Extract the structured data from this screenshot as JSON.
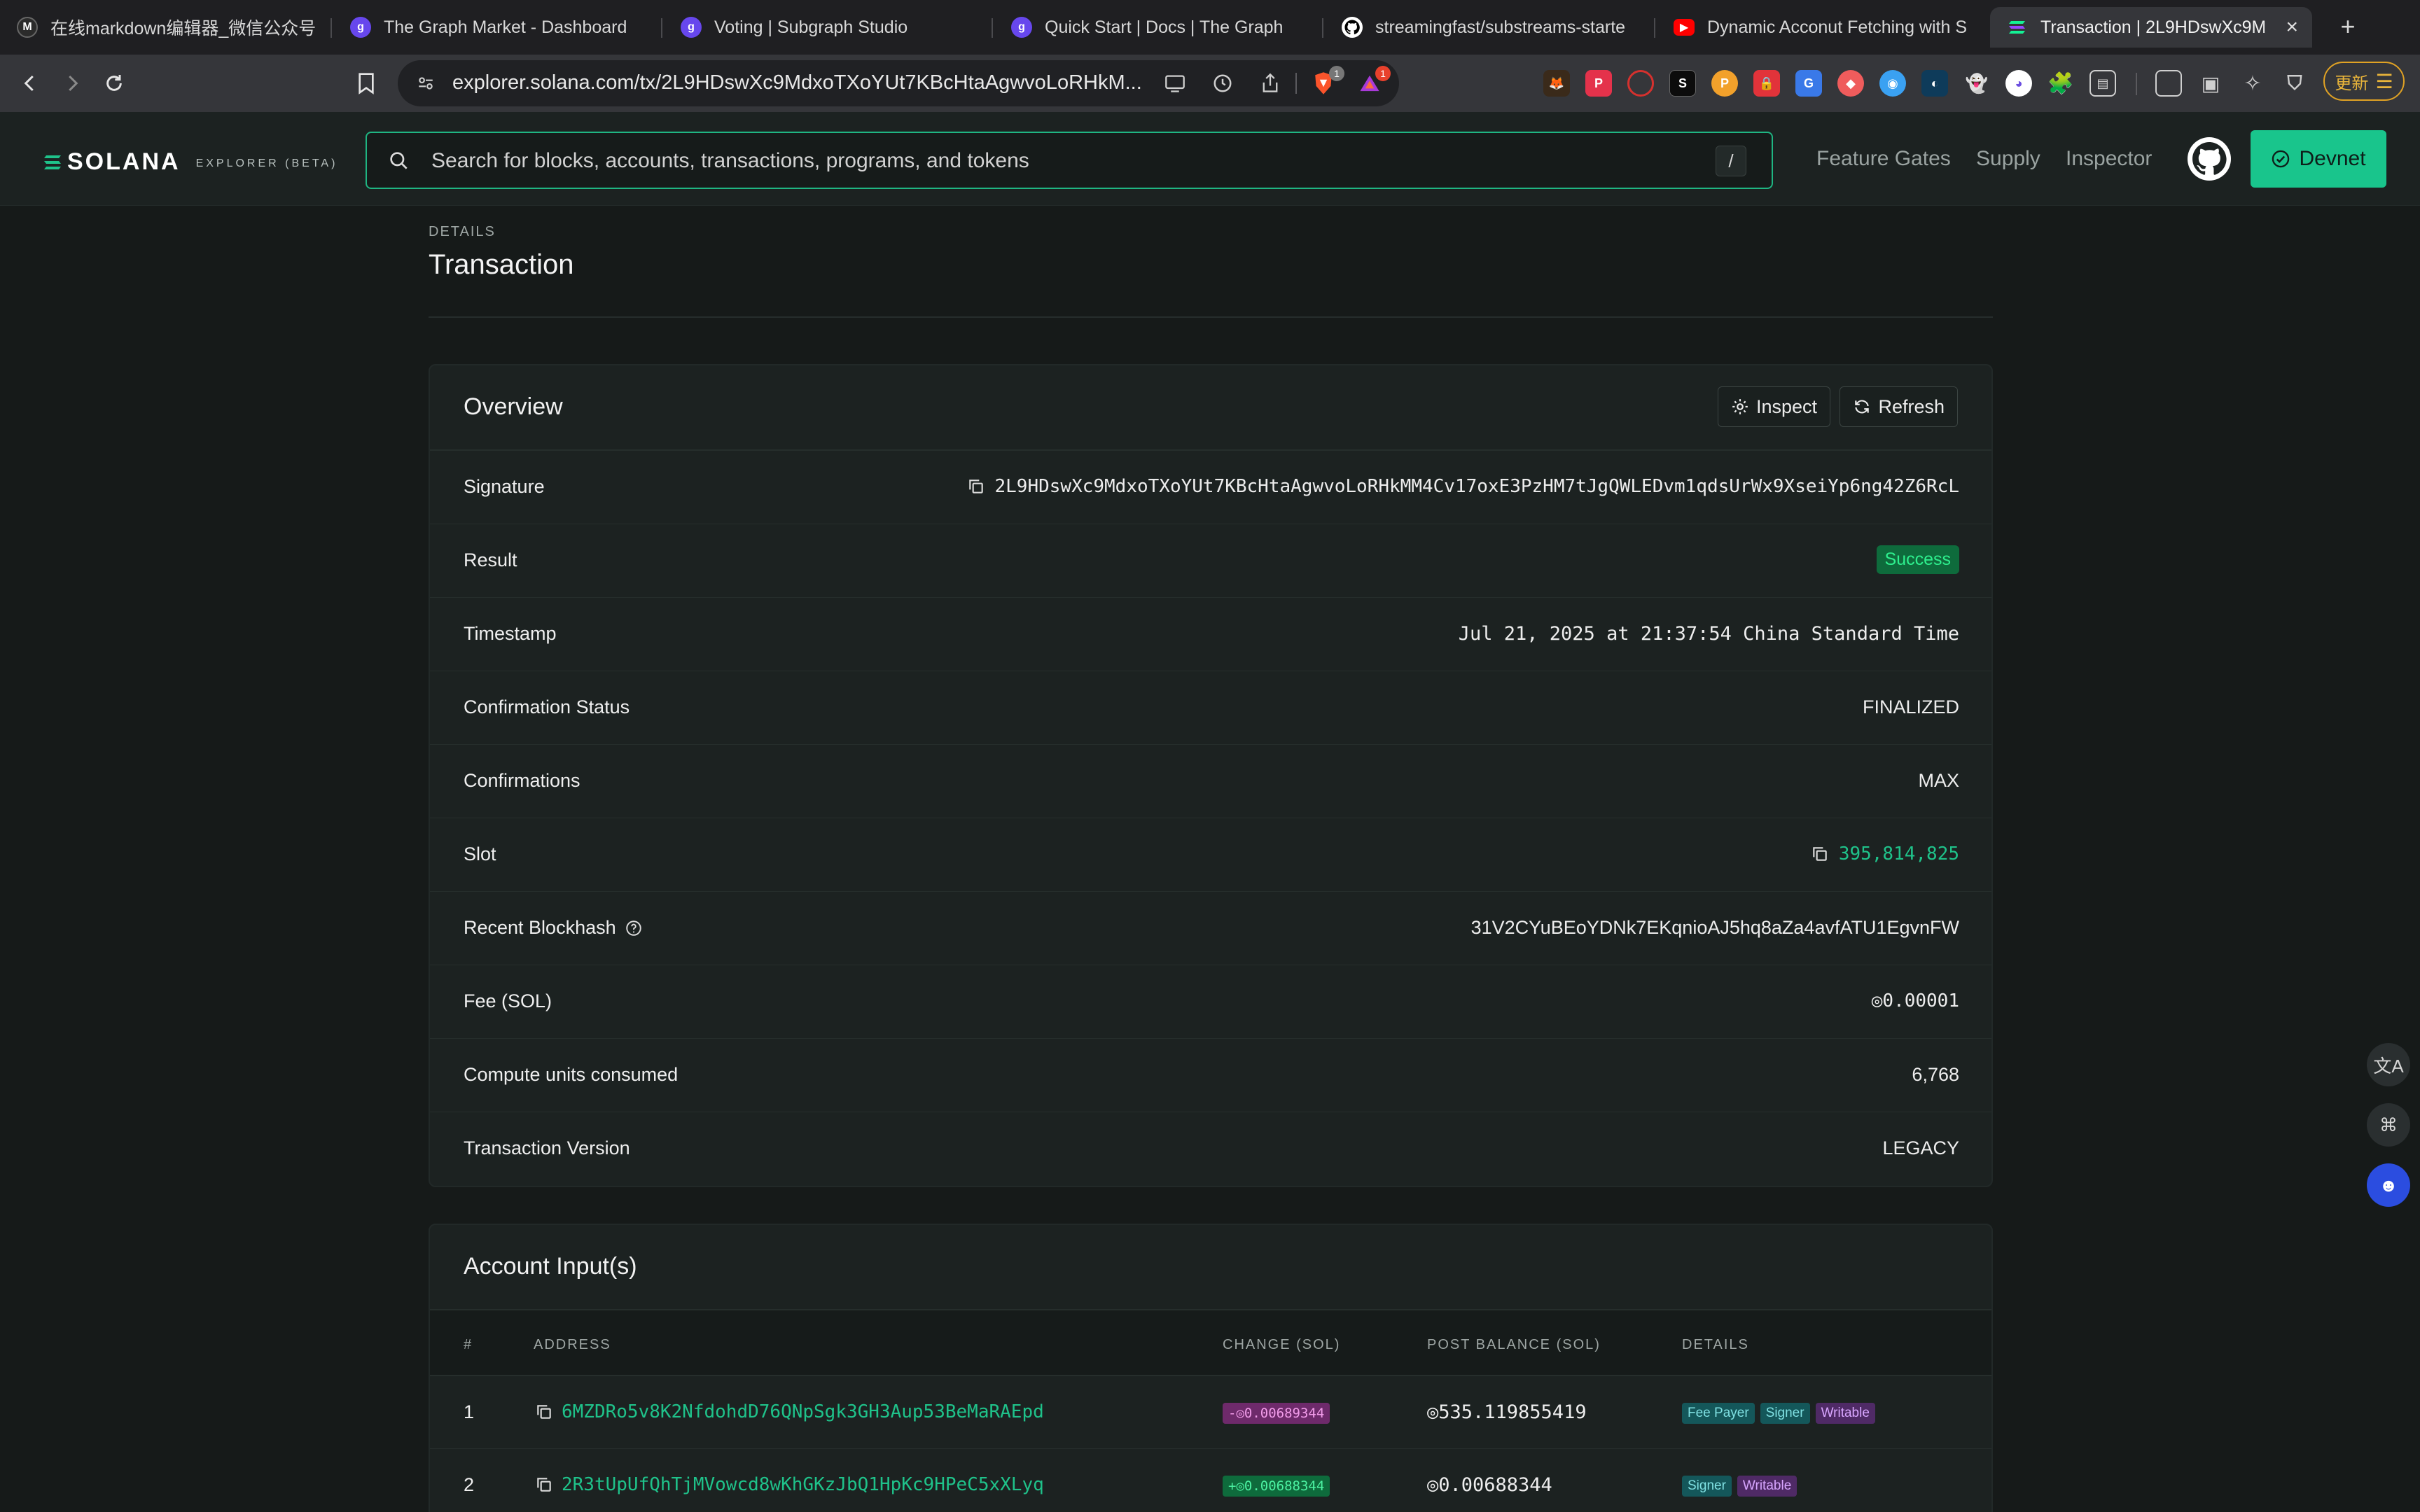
{
  "browser": {
    "tabs": [
      {
        "title": "在线markdown编辑器_微信公众号",
        "icon": "markdown-icon",
        "color": "#2b2b2b"
      },
      {
        "title": "The Graph Market - Dashboard",
        "icon": "the-graph-icon",
        "color": "#6747ed"
      },
      {
        "title": "Voting | Subgraph Studio",
        "icon": "the-graph-icon",
        "color": "#6747ed"
      },
      {
        "title": "Quick Start | Docs | The Graph",
        "icon": "the-graph-icon",
        "color": "#6747ed"
      },
      {
        "title": "streamingfast/substreams-starte",
        "icon": "github-icon",
        "color": "#000000"
      },
      {
        "title": "Dynamic Acconut Fetching with S",
        "icon": "youtube-icon",
        "color": "#ff0000"
      },
      {
        "title": "Transaction | 2L9HDswXc9M",
        "icon": "solana-icon",
        "color": "#14f195"
      }
    ],
    "url": "explorer.solana.com/tx/2L9HDswXc9MdxoTXoYUt7KBcHtaAgwvoLoRHkM...",
    "update_label": "更新",
    "ext_badges": [
      "1",
      "1"
    ]
  },
  "header": {
    "logo_text": "SOLANA",
    "logo_sub": "EXPLORER (BETA)",
    "search_placeholder": "Search for blocks, accounts, transactions, programs, and tokens",
    "search_shortcut": "/",
    "nav": [
      "Feature Gates",
      "Supply",
      "Inspector"
    ],
    "cluster_label": "Devnet",
    "accent": "#19c58c"
  },
  "page": {
    "pre_title": "DETAILS",
    "title": "Transaction"
  },
  "overview": {
    "title": "Overview",
    "inspect_label": "Inspect",
    "refresh_label": "Refresh",
    "rows": {
      "signature": {
        "label": "Signature",
        "value": "2L9HDswXc9MdxoTXoYUt7KBcHtaAgwvoLoRHkMM4Cv17oxE3PzHM7tJgQWLEDvm1qdsUrWx9XseiYp6ng42Z6RcL"
      },
      "result": {
        "label": "Result",
        "value": "Success"
      },
      "timestamp": {
        "label": "Timestamp",
        "value": "Jul 21, 2025 at 21:37:54 China Standard Time"
      },
      "confirmation_status": {
        "label": "Confirmation Status",
        "value": "FINALIZED"
      },
      "confirmations": {
        "label": "Confirmations",
        "value": "MAX"
      },
      "slot": {
        "label": "Slot",
        "value": "395,814,825"
      },
      "recent_blockhash": {
        "label": "Recent Blockhash",
        "value": "31V2CYuBEoYDNk7EKqnioAJ5hq8aZa4avfATU1EgvnFW"
      },
      "fee": {
        "label": "Fee (SOL)",
        "value": "◎0.00001"
      },
      "compute_units": {
        "label": "Compute units consumed",
        "value": "6,768"
      },
      "version": {
        "label": "Transaction Version",
        "value": "LEGACY"
      }
    }
  },
  "accounts": {
    "title": "Account Input(s)",
    "columns": [
      "#",
      "ADDRESS",
      "CHANGE (SOL)",
      "POST BALANCE (SOL)",
      "DETAILS"
    ],
    "rows": [
      {
        "index": "1",
        "address": "6MZDRo5v8K2NfdohdD76QNpSgk3GH3Aup53BeMaRAEpd",
        "change": "-◎0.00689344",
        "post_balance": "◎535.119855419",
        "tags": [
          "Fee Payer",
          "Signer",
          "Writable"
        ]
      },
      {
        "index": "2",
        "address": "2R3tUpUfQhTjMVowcd8wKhGKzJbQ1HpKc9HPeC5xXLyq",
        "change": "+◎0.00688344",
        "post_balance": "◎0.00688344",
        "tags": [
          "Signer",
          "Writable"
        ]
      }
    ]
  }
}
